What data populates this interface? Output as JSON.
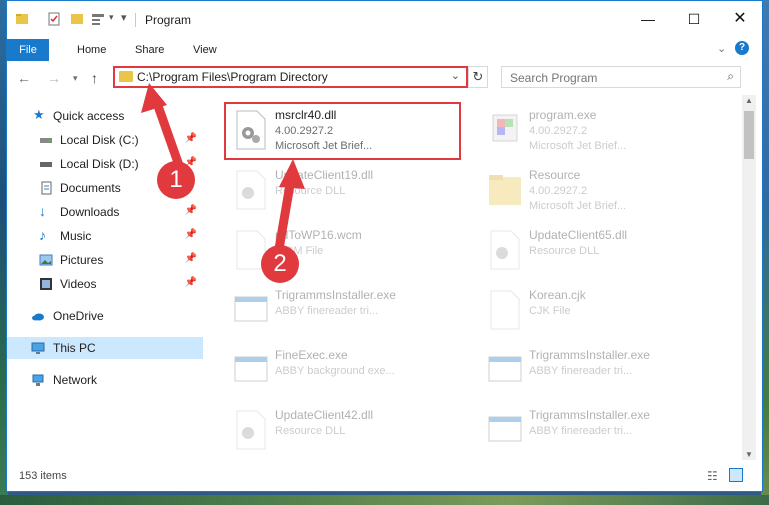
{
  "window": {
    "title": "Program"
  },
  "ribbon": {
    "tabs": [
      "File",
      "Home",
      "Share",
      "View"
    ]
  },
  "address": {
    "path": "C:\\Program Files\\Program Directory"
  },
  "search": {
    "placeholder": "Search Program"
  },
  "nav": {
    "items": [
      {
        "label": "Quick access",
        "icon": "star-icon",
        "pinned": false
      },
      {
        "label": "Local Disk (C:)",
        "icon": "drive-icon",
        "pinned": true
      },
      {
        "label": "Local Disk (D:)",
        "icon": "drive-icon",
        "pinned": true
      },
      {
        "label": "Documents",
        "icon": "documents-icon",
        "pinned": false
      },
      {
        "label": "Downloads",
        "icon": "download-icon",
        "pinned": true
      },
      {
        "label": "Music",
        "icon": "music-icon",
        "pinned": true
      },
      {
        "label": "Pictures",
        "icon": "pictures-icon",
        "pinned": true
      },
      {
        "label": "Videos",
        "icon": "videos-icon",
        "pinned": true
      },
      {
        "label": "OneDrive",
        "icon": "cloud-icon",
        "pinned": false
      },
      {
        "label": "This PC",
        "icon": "pc-icon",
        "pinned": false,
        "selected": true
      },
      {
        "label": "Network",
        "icon": "network-icon",
        "pinned": false
      }
    ]
  },
  "files": [
    {
      "name": "msrclr40.dll",
      "line2": "4.00.2927.2",
      "line3": "Microsoft Jet Brief...",
      "icon": "dll-icon"
    },
    {
      "name": "program.exe",
      "line2": "4.00.2927.2",
      "line3": "Microsoft Jet Brief...",
      "icon": "exe-icon"
    },
    {
      "name": "UpdateClient19.dll",
      "line2": "Resource DLL",
      "line3": "",
      "icon": "dll-icon"
    },
    {
      "name": "Resource",
      "line2": "4.00.2927.2",
      "line3": "Microsoft Jet Brief...",
      "icon": "folder-icon"
    },
    {
      "name": "pdToWP16.wcm",
      "line2": "WCM File",
      "line3": "",
      "icon": "file-icon"
    },
    {
      "name": "UpdateClient65.dll",
      "line2": "Resource DLL",
      "line3": "",
      "icon": "dll-icon"
    },
    {
      "name": "TrigrammsInstaller.exe",
      "line2": "ABBY finereader tri...",
      "line3": "",
      "icon": "app-icon"
    },
    {
      "name": "Korean.cjk",
      "line2": "CJK File",
      "line3": "",
      "icon": "file-icon"
    },
    {
      "name": "FineExec.exe",
      "line2": "ABBY background exe...",
      "line3": "",
      "icon": "app-icon"
    },
    {
      "name": "TrigrammsInstaller.exe",
      "line2": "ABBY finereader tri...",
      "line3": "",
      "icon": "app-icon"
    },
    {
      "name": "UpdateClient42.dll",
      "line2": "Resource DLL",
      "line3": "",
      "icon": "dll-icon"
    },
    {
      "name": "TrigrammsInstaller.exe",
      "line2": "ABBY finereader tri...",
      "line3": "",
      "icon": "app-icon"
    }
  ],
  "status": {
    "count": "153 items"
  },
  "callouts": [
    "1",
    "2"
  ],
  "colors": {
    "accent": "#1979ca",
    "highlight": "#e0393e",
    "selected": "#cce8ff"
  }
}
